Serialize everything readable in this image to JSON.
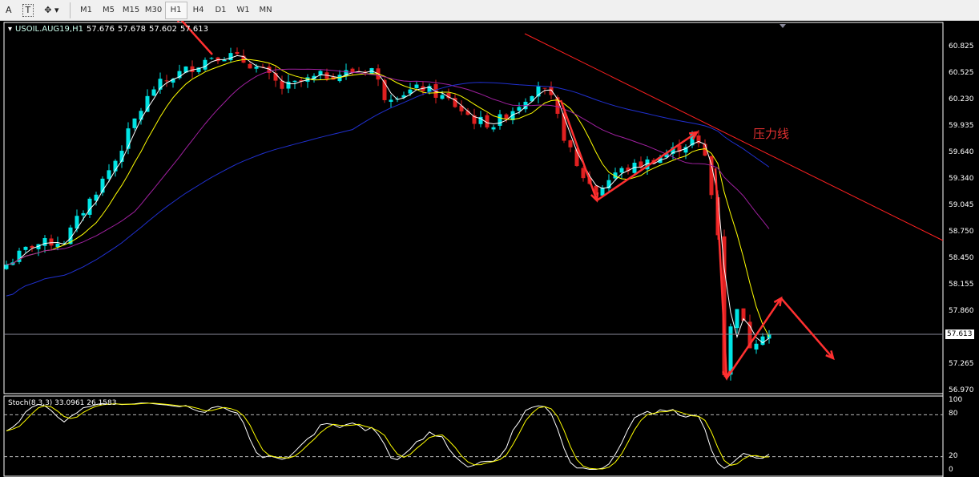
{
  "toolbar": {
    "text_tool": "A",
    "text_label_tool": "T",
    "timeframes": [
      "M1",
      "M5",
      "M15",
      "M30",
      "H1",
      "H4",
      "D1",
      "W1",
      "MN"
    ],
    "active": "H1"
  },
  "header": {
    "symbol": "USOIL.AUG19,H1",
    "open": "57.676",
    "high": "57.678",
    "low": "57.602",
    "close": "57.613"
  },
  "price_axis": [
    "60.825",
    "60.525",
    "60.230",
    "59.935",
    "59.640",
    "59.340",
    "59.045",
    "58.750",
    "58.450",
    "58.155",
    "57.860",
    "57.265",
    "56.970"
  ],
  "current_price": "57.613",
  "annotation": "压力线",
  "stoch": {
    "label": "Stoch(8,3,3) 33.0961 26.1583",
    "levels": [
      "100",
      "80",
      "20",
      "0"
    ]
  },
  "colors": {
    "bull": "#00e5e5",
    "bear": "#e02020",
    "ma1": "#ffffff",
    "ma2": "#ffff00",
    "ma3": "#a020a0",
    "ma4": "#2030d0",
    "trend": "#ff2020"
  },
  "chart_data": {
    "type": "candlestick",
    "ylim": [
      56.97,
      60.825
    ],
    "keypoints": [
      [
        0,
        58.39
      ],
      [
        4,
        58.61
      ],
      [
        9,
        58.66
      ],
      [
        13,
        59.11
      ],
      [
        17,
        59.56
      ],
      [
        20,
        60.01
      ],
      [
        23,
        60.37
      ],
      [
        26,
        60.5
      ],
      [
        30,
        60.64
      ],
      [
        32,
        60.73
      ],
      [
        35,
        60.73
      ],
      [
        38,
        60.64
      ],
      [
        40,
        60.55
      ],
      [
        43,
        60.37
      ],
      [
        45,
        60.41
      ],
      [
        49,
        60.5
      ],
      [
        54,
        60.55
      ],
      [
        57,
        60.59
      ],
      [
        59,
        60.28
      ],
      [
        62,
        60.32
      ],
      [
        65,
        60.37
      ],
      [
        69,
        60.23
      ],
      [
        73,
        60.01
      ],
      [
        76,
        59.96
      ],
      [
        80,
        60.19
      ],
      [
        83,
        60.41
      ],
      [
        85,
        60.23
      ],
      [
        87,
        59.83
      ],
      [
        89,
        59.47
      ],
      [
        92,
        59.2
      ],
      [
        95,
        59.42
      ],
      [
        99,
        59.51
      ],
      [
        102,
        59.6
      ],
      [
        106,
        59.74
      ],
      [
        107,
        59.83
      ],
      [
        109,
        59.6
      ],
      [
        111,
        58.75
      ],
      [
        112,
        57.18
      ],
      [
        113,
        57.67
      ],
      [
        114,
        57.94
      ],
      [
        116,
        57.49
      ],
      [
        118,
        57.63
      ],
      [
        119,
        57.61
      ]
    ]
  }
}
